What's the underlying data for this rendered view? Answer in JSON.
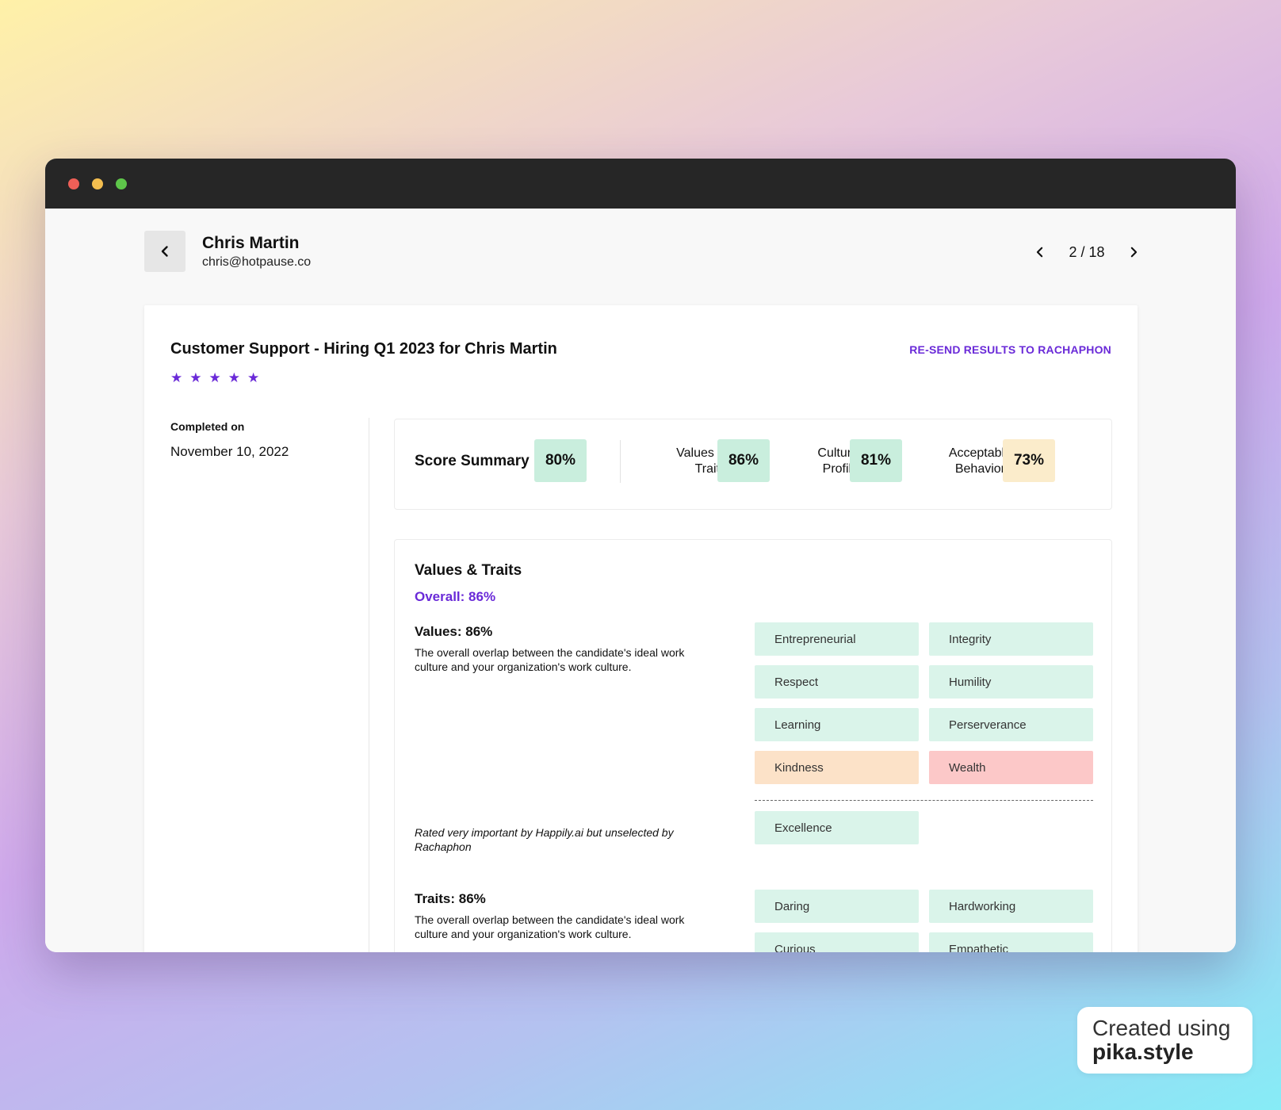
{
  "candidate": {
    "name": "Chris Martin",
    "email": "chris@hotpause.co"
  },
  "pager": {
    "text": "2 / 18"
  },
  "report": {
    "title": "Customer Support - Hiring Q1 2023 for Chris Martin",
    "resend_label": "RE-SEND RESULTS TO RACHAPHON",
    "stars": 5,
    "completed_label": "Completed on",
    "completed_date": "November 10, 2022"
  },
  "summary": {
    "title": "Score Summary",
    "overall": "80%",
    "values_traits": {
      "label_line1": "Values &",
      "label_line2": "Traits",
      "value": "86%"
    },
    "culture_profile": {
      "label_line1": "Culture",
      "label_line2": "Profile",
      "value": "81%"
    },
    "acceptable_behaviors": {
      "label_line1": "Acceptable",
      "label_line2": "Behaviors",
      "value": "73%"
    }
  },
  "values_traits": {
    "title": "Values & Traits",
    "overall": "Overall: 86%",
    "values": {
      "title": "Values: 86%",
      "description": "The overall overlap between the candidate's ideal work culture and your organization's work culture.",
      "chips": [
        "Entrepreneurial",
        "Integrity",
        "Respect",
        "Humility",
        "Learning",
        "Perserverance",
        "Kindness",
        "Wealth"
      ],
      "note": "Rated very important by Happily.ai but unselected by Rachaphon",
      "note_chip": "Excellence"
    },
    "traits": {
      "title": "Traits: 86%",
      "description": "The overall overlap between the candidate's ideal work culture and your organization's work culture.",
      "chips": [
        "Daring",
        "Hardworking",
        "Curious",
        "Empathetic"
      ]
    }
  },
  "colors": {
    "accent": "#6a2ad8",
    "chip_green": "#daf4ea",
    "chip_orange": "#fce2c8",
    "chip_red": "#fcc8c8",
    "badge_green": "#c9eedd",
    "badge_amber": "#fbeccb"
  },
  "credit": {
    "line1": "Created using",
    "line2": "pika.style"
  }
}
